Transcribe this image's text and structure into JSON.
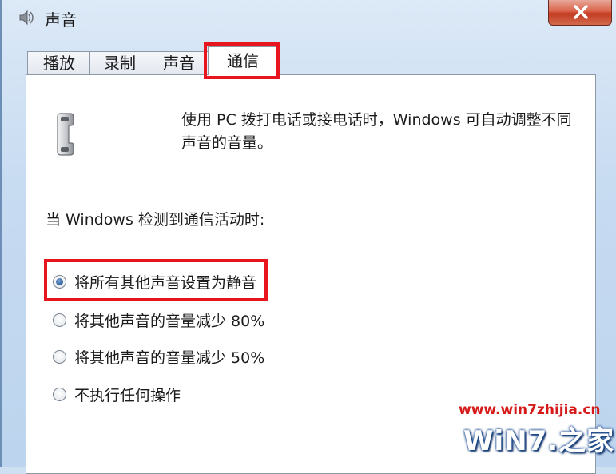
{
  "window": {
    "title": "声音"
  },
  "tabs": [
    {
      "label": "播放"
    },
    {
      "label": "录制"
    },
    {
      "label": "声音"
    },
    {
      "label": "通信",
      "active": true
    }
  ],
  "panel": {
    "description_line1": "使用 PC 拨打电话或接电话时，Windows 可自动调整不同",
    "description_line2": "声音的音量。",
    "group_label": "当 Windows 检测到通信活动时:",
    "options": [
      {
        "label": "将所有其他声音设置为静音",
        "checked": true
      },
      {
        "label": "将其他声音的音量减少 80%",
        "checked": false
      },
      {
        "label": "将其他声音的音量减少 50%",
        "checked": false
      },
      {
        "label": "不执行任何操作",
        "checked": false
      }
    ]
  },
  "watermark": {
    "url": "www.win7zhijia.cn",
    "logo": "WiN7.之家"
  },
  "colors": {
    "highlight": "#e8141e",
    "close_button": "#c23b22",
    "watermark_red": "#d61a1a"
  },
  "icons": [
    "speaker-icon",
    "close-icon",
    "telephone-icon"
  ]
}
